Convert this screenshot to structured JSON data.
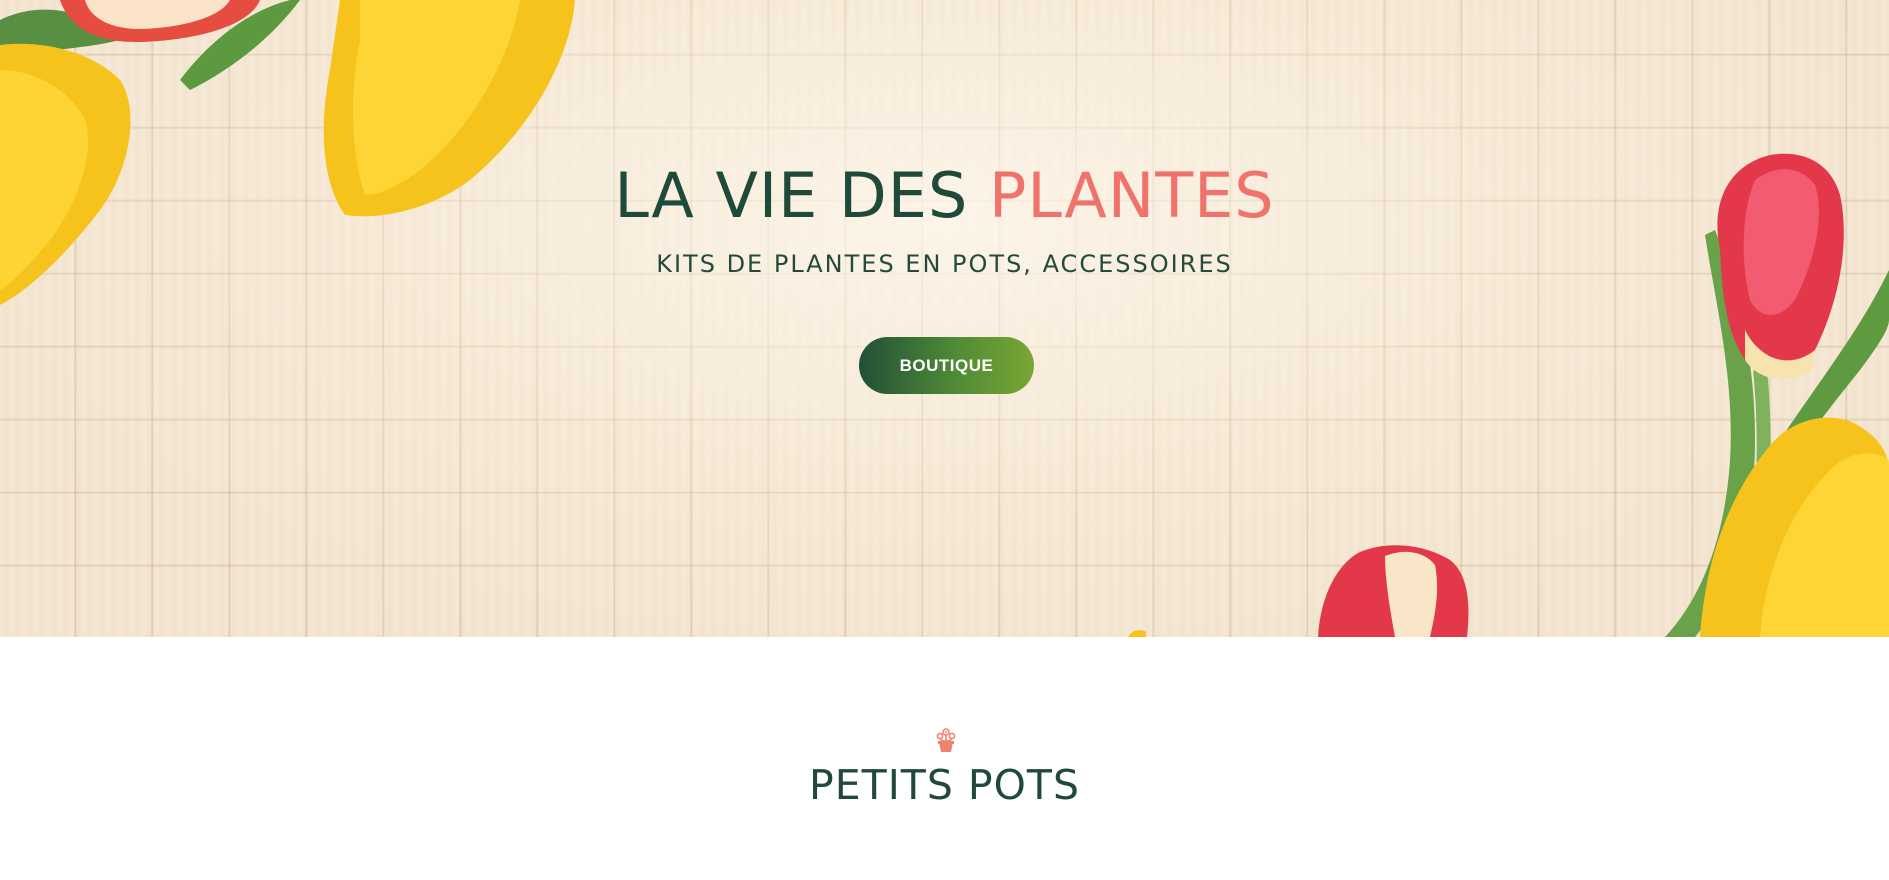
{
  "hero": {
    "title_main": "LA VIE DES ",
    "title_accent": "PLANTES",
    "subtitle": "KITS DE PLANTES EN POTS, ACCESSOIRES",
    "button_label": "BOUTIQUE",
    "background_image": "woven-mat-with-tulips",
    "colors": {
      "title": "#1f4a3a",
      "accent": "#f0736b",
      "button_gradient_start": "#214f38",
      "button_gradient_end": "#79a733"
    }
  },
  "section": {
    "icon": "flower-pot-icon",
    "title": "PETITS POTS",
    "icon_color": "#f0836f"
  }
}
